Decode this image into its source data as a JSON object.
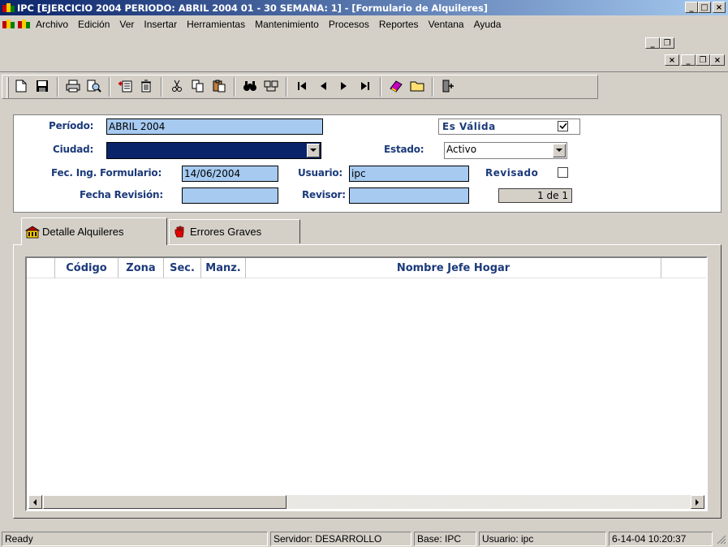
{
  "window": {
    "title": "IPC [EJERCICIO 2004 PERIODO: ABRIL 2004 01 - 30 SEMANA: 1] - [Formulario de Alquileres]",
    "min_label": "_",
    "max_label": "□",
    "close_label": "×"
  },
  "menu": {
    "items": [
      "Archivo",
      "Edición",
      "Ver",
      "Insertar",
      "Herramientas",
      "Mantenimiento",
      "Procesos",
      "Reportes",
      "Ventana",
      "Ayuda"
    ],
    "mdi_buttons": {
      "min": "_",
      "restore": "❐",
      "close": "×"
    }
  },
  "toolbar": {
    "buttons": [
      "new-icon",
      "save-icon",
      "print-icon",
      "print-preview-icon",
      "add-record-icon",
      "delete-icon",
      "cut-icon",
      "copy-icon",
      "paste-icon",
      "find-icon",
      "find-replace-icon",
      "first-record-icon",
      "previous-record-icon",
      "next-record-icon",
      "last-record-icon",
      "help-book-icon",
      "open-folder-icon",
      "exit-icon"
    ]
  },
  "form": {
    "periodo_label": "Período:",
    "periodo_value": "ABRIL 2004",
    "ciudad_label": "Ciudad:",
    "ciudad_value": "",
    "fec_ing_label": "Fec. Ing. Formulario:",
    "fec_ing_value": "14/06/2004",
    "fecha_revision_label": "Fecha Revisión:",
    "fecha_revision_value": "",
    "es_valida_label": "Es Válida",
    "es_valida_checked": true,
    "estado_label": "Estado:",
    "estado_value": "Activo",
    "usuario_label": "Usuario:",
    "usuario_value": "ipc",
    "revisor_label": "Revisor:",
    "revisor_value": "",
    "revisado_label": "Revisado",
    "revisado_checked": false,
    "record_counter": "1 de 1"
  },
  "tabs": [
    {
      "label": "Detalle Alquileres",
      "icon": "building-icon",
      "active": true
    },
    {
      "label": "Errores Graves",
      "icon": "stop-hand-icon",
      "active": false
    }
  ],
  "grid": {
    "columns": [
      "Código",
      "Zona",
      "Sec.",
      "Manz.",
      "Nombre Jefe Hogar"
    ],
    "rows": []
  },
  "status": {
    "ready": "Ready",
    "servidor": "Servidor: DESARROLLO",
    "base": "Base: IPC",
    "usuario": "Usuario: ipc",
    "datetime": "6-14-04 10:20:37"
  },
  "colors": {
    "title_gradient_start": "#0a246a",
    "title_gradient_end": "#a6caf0",
    "field_bg": "#a6caf0",
    "label_color": "#1c3a7a",
    "selection": "#0a246a"
  }
}
